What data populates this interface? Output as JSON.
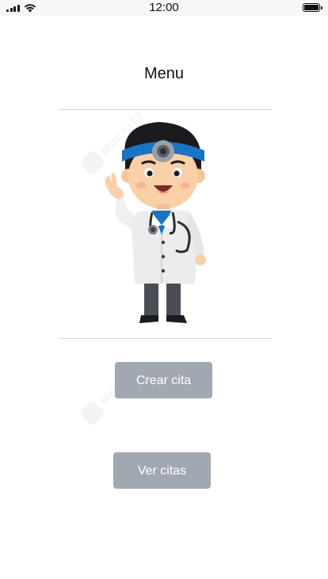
{
  "status_bar": {
    "time": "12:00",
    "icons": [
      "signal-icon",
      "wifi-icon",
      "battery-icon"
    ]
  },
  "header": {
    "title": "Menu"
  },
  "illustration": {
    "subject": "doctor-illustration"
  },
  "actions": {
    "create_label": "Crear cita",
    "view_label": "Ver citas"
  },
  "watermark": {
    "text": "MOCKITT"
  },
  "colors": {
    "button_bg": "#a1a8b1",
    "button_text": "#ffffff",
    "divider": "#d8d8d8",
    "status_bar_bg": "#f7f7f7"
  }
}
